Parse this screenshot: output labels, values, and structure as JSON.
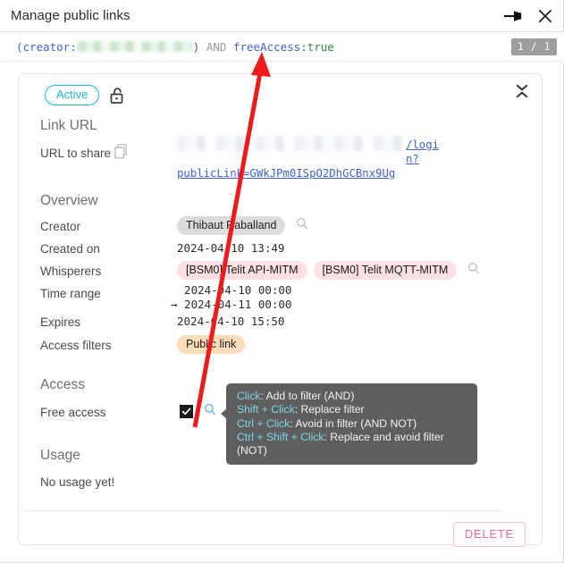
{
  "window": {
    "title": "Manage public links",
    "pin_icon": "pin-icon",
    "close_icon": "close-icon"
  },
  "query_bar": {
    "open_paren": "(",
    "field_creator": "creator:",
    "redacted_value": "",
    "close_paren": ")",
    "operator": "AND",
    "field_free_access": "freeAccess",
    "colon": ":",
    "value_true": "true",
    "result_count": "1 / 1"
  },
  "card": {
    "status_badge": "Active",
    "lock_icon": "unlock-icon",
    "collapse_icon": "collapse-icon",
    "link_url": {
      "section_title": "Link URL",
      "label": "URL to share",
      "copy_icon": "copy-icon",
      "url_visible_tail": "/login?",
      "url_second_line": "publicLink=GWkJPm0ISpO2DhGCBnx9Ug"
    },
    "overview": {
      "section_title": "Overview",
      "rows": [
        {
          "label": "Creator",
          "value": "Thibaut Raballand",
          "kind": "chip-gray",
          "search": true
        },
        {
          "label": "Created on",
          "value": "2024-04-10 13:49",
          "kind": "mono",
          "search": false
        },
        {
          "label": "Whisperers",
          "value": "",
          "kind": "chips",
          "search": true,
          "chips": [
            "[BSM0] Telit API-MITM",
            "[BSM0] Telit MQTT-MITM"
          ]
        },
        {
          "label": "Time range",
          "value": "  2024-04-10 00:00\n→ 2024-04-11 00:00",
          "kind": "mono",
          "search": false
        },
        {
          "label": "Expires",
          "value": "2024-04-10 15:50",
          "kind": "mono",
          "search": false
        },
        {
          "label": "Access filters",
          "value": "Public link",
          "kind": "chip-orange",
          "search": false
        }
      ]
    },
    "access": {
      "section_title": "Access",
      "label": "Free access",
      "checked": true,
      "search_icon": "search-icon"
    },
    "usage": {
      "section_title": "Usage",
      "text": "No usage yet!"
    },
    "delete_label": "DELETE"
  },
  "tooltip": {
    "lines": [
      {
        "key": "Click",
        "desc": ": Add to filter (AND)"
      },
      {
        "key": "Shift + Click",
        "desc": ": Replace filter"
      },
      {
        "key": "Ctrl + Click",
        "desc": ": Avoid in filter (AND NOT)"
      },
      {
        "key": "Ctrl + Shift + Click",
        "desc": ": Replace and avoid filter (NOT)"
      }
    ]
  },
  "annotation": {
    "arrow_color": "#ef1b1b",
    "points_to": "freeAccess"
  }
}
